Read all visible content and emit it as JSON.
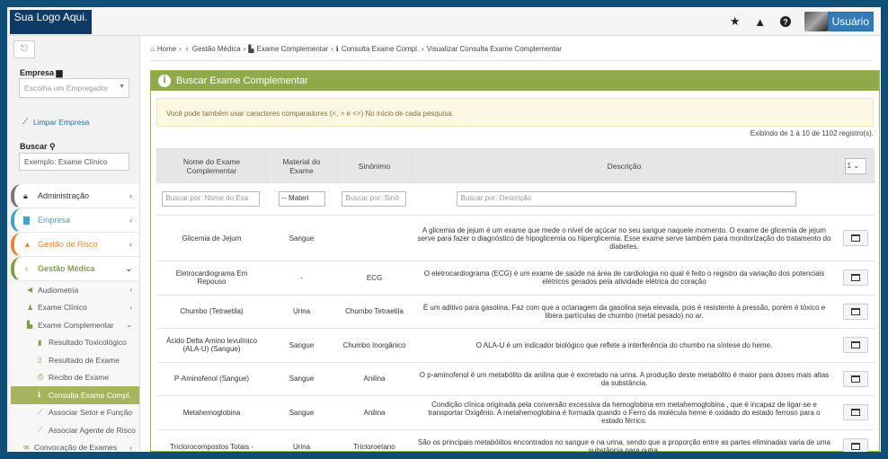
{
  "header": {
    "logo": "Sua Logo Aqui.",
    "icons": [
      "star-icon",
      "warning-icon",
      "help-icon"
    ],
    "user_label": "Usuário"
  },
  "sidebar": {
    "empresa_label": "Empresa",
    "empresa_placeholder": "Escolha um Empregador",
    "limpar_label": "Limpar Empresa",
    "buscar_label": "Buscar",
    "buscar_value": "Exemplo: Exame Clínico",
    "menu": [
      {
        "label": "Administração",
        "icon": "lock-icon"
      },
      {
        "label": "Empresa",
        "icon": "building-icon"
      },
      {
        "label": "Gestão de Risco",
        "icon": "warning-icon"
      },
      {
        "label": "Gestão Médica",
        "icon": "stethoscope-icon"
      }
    ],
    "sub": [
      {
        "label": "Audiometria"
      },
      {
        "label": "Exame Clínico"
      },
      {
        "label": "Exame Complementar"
      }
    ],
    "sub2": [
      {
        "label": "Resultado Toxicológico"
      },
      {
        "label": "Resultado de Exame"
      },
      {
        "label": "Recibo de Exame"
      },
      {
        "label": "Consulta Exame Compl."
      },
      {
        "label": "Associar Setor e Função"
      },
      {
        "label": "Associar Agente de Risco"
      }
    ],
    "convocacao": "Convocação de Exames"
  },
  "breadcrumb": [
    "Home",
    "Gestão Médica",
    "Exame Complementar",
    "Consulta Exame Compl.",
    "Visualizar Consulta Exame Complementar"
  ],
  "panel": {
    "title": "Buscar Exame Complementar",
    "alert": "Você pode também usar caracteres comparadores (<, > e <>) No início de cada pesquisa.",
    "count": "Exibindo de 1 à 10 de 1102 registro(s)."
  },
  "table": {
    "headers": [
      "Nome do Exame Complementar",
      "Material do Exame",
      "Sinônimo",
      "Descrição"
    ],
    "page_size": "1",
    "filters": {
      "nome": "Buscar por: Nome do Exa",
      "material": "-- Materi",
      "sinonimo": "Buscar por: Sinô",
      "descricao": "Buscar por: Descrição"
    },
    "rows": [
      {
        "nome": "Glicemia de Jejum",
        "material": "Sangue",
        "sinonimo": "",
        "descricao": "A glicemia de jejum é um exame que mede o nível de açúcar no seu sangue naquele momento. O exame de glicemia de jejum serve para fazer o diagnóstico de hipoglicemia ou hiperglicemia. Esse exame serve também para monitorização do tratamento do diabetes."
      },
      {
        "nome": "Eletrocardiograma Em Repouso",
        "material": "-",
        "sinonimo": "ECG",
        "descricao": "O eletrocardiograma (ECG) é um exame de saúde na área de cardiologia no qual é feito o registro da variação dos potenciais elétricos gerados pela atividade elétrica do coração"
      },
      {
        "nome": "Chumbo (Tetraetila)",
        "material": "Urina",
        "sinonimo": "Chumbo Tetraetila",
        "descricao": "É um aditivo para gasolina. Faz com que a octanagem da gasolina seja elevada, pois é resistente à pressão, porém é tóxico e libera partículas de chumbo (metal pesado) no ar."
      },
      {
        "nome": "Ácido Delta Amino levulínico (ALA-U) (Sangue)",
        "material": "Sangue",
        "sinonimo": "Chumbo Inorgânico",
        "descricao": "O ALA-U é um indicador biológico que reflete a interferência do chumbo na síntese do heme."
      },
      {
        "nome": "P-Aminofenol (Sangue)",
        "material": "Sangue",
        "sinonimo": "Anilina",
        "descricao": "O p-aminofenol é um metabólito da anilina que é excretado na urina. A produção deste metabólito é maior para doses mais altas da substância."
      },
      {
        "nome": "Metahemoglobina",
        "material": "Sangue",
        "sinonimo": "Anilina",
        "descricao": "Condição clínica originada pela conversão excessiva da hemoglobina em metahemoglobina , que é incapaz de ligar-se e transportar Oxigênio. A metahemoglobina é formada quando o Ferro da molécula heme é oxidado do estado ferroso para o estado férrico."
      },
      {
        "nome": "Triclorocompostos Totais -",
        "material": "Urina",
        "sinonimo": "Tricloroetano",
        "descricao": "São os principais metabólitos encontrados no sangue e na urina, sendo que a proporção entre as partes eliminadas varia de uma substância para outra."
      }
    ]
  }
}
